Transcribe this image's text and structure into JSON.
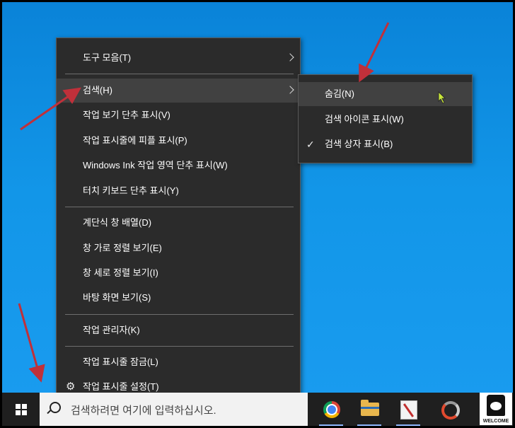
{
  "context_menu": {
    "items": [
      {
        "label": "도구 모음(T)"
      },
      {
        "label": "검색(H)"
      },
      {
        "label": "작업 보기 단추 표시(V)"
      },
      {
        "label": "작업 표시줄에 피플 표시(P)"
      },
      {
        "label": "Windows Ink 작업 영역 단추 표시(W)"
      },
      {
        "label": "터치 키보드 단추 표시(Y)"
      },
      {
        "label": "계단식 창 배열(D)"
      },
      {
        "label": "창 가로 정렬 보기(E)"
      },
      {
        "label": "창 세로 정렬 보기(I)"
      },
      {
        "label": "바탕 화면 보기(S)"
      },
      {
        "label": "작업 관리자(K)"
      },
      {
        "label": "작업 표시줄 잠금(L)"
      },
      {
        "label": "작업 표시줄 설정(T)",
        "icon": "gear-icon"
      }
    ],
    "highlighted": "검색(H)"
  },
  "search_submenu": {
    "items": [
      {
        "label": "숨김(N)"
      },
      {
        "label": "검색 아이콘 표시(W)"
      },
      {
        "label": "검색 상자 표시(B)",
        "checked": true
      }
    ],
    "highlighted": "숨김(N)"
  },
  "taskbar": {
    "search_placeholder": "검색하려면 여기에 입력하십시오.",
    "apps": [
      "chrome-icon",
      "file-explorer-icon",
      "paint-icon",
      "app-ring-icon"
    ],
    "corner_badge": "WELCOME"
  },
  "colors": {
    "desktop": "#1296e8",
    "menu_bg": "#2b2b2b",
    "menu_highlight": "#414141",
    "taskbar": "#1f1f1f",
    "annotation_arrow": "#c0303a"
  }
}
